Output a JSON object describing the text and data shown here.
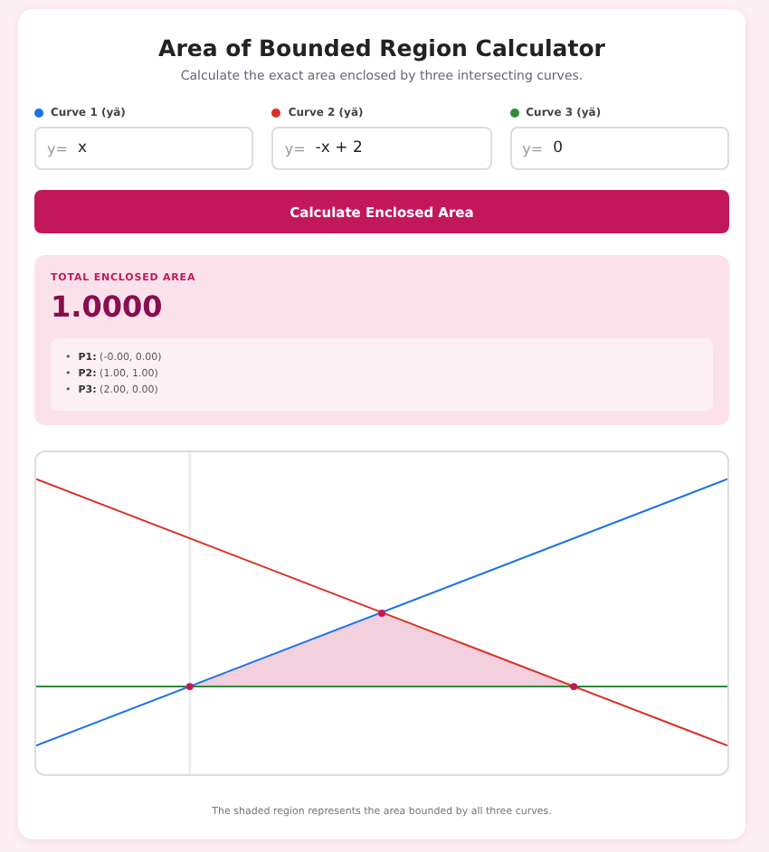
{
  "title": "Area of Bounded Region Calculator",
  "subtitle": "Calculate the exact area enclosed by three intersecting curves.",
  "curves": [
    {
      "label": "Curve 1 (yä)",
      "color": "#1a73e8",
      "prefix": "y=",
      "value": "x"
    },
    {
      "label": "Curve 2 (yä)",
      "color": "#d93025",
      "prefix": "y=",
      "value": "-x + 2"
    },
    {
      "label": "Curve 3 (yä)",
      "color": "#2e8b3a",
      "prefix": "y=",
      "value": "0"
    }
  ],
  "button": "Calculate Enclosed Area",
  "result": {
    "label": "TOTAL ENCLOSED AREA",
    "value": "1.0000",
    "points": [
      {
        "marker": "•",
        "text": "**P1:** (-0.00, 0.00)"
      },
      {
        "marker": "•",
        "text": "**P2:** (1.00, 1.00)"
      },
      {
        "marker": "•",
        "text": "**P3:** (2.00, 0.00)"
      }
    ]
  },
  "caption": "The shaded region represents the area bounded by all three curves."
}
